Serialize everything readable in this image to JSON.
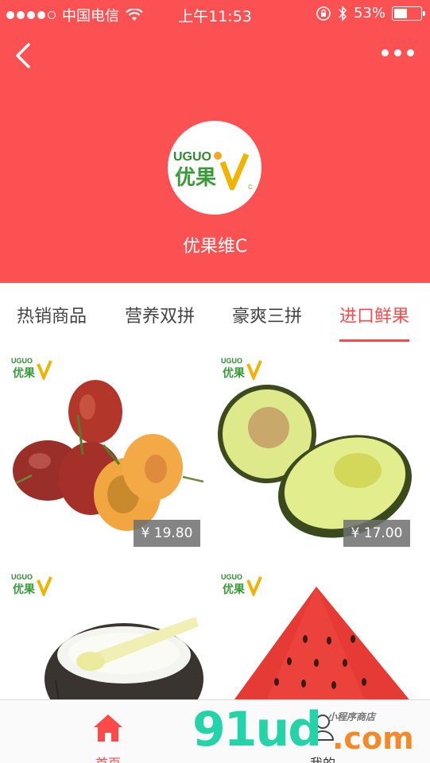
{
  "status_bar": {
    "carrier": "中国电信",
    "time": "上午11:53",
    "battery": "53%",
    "battery_level": 0.53
  },
  "header": {
    "store_name": "优果维C",
    "logo_text": "UGUO",
    "logo_cn": "优果"
  },
  "tabs": [
    {
      "label": "热销商品",
      "active": false
    },
    {
      "label": "营养双拼",
      "active": false
    },
    {
      "label": "豪爽三拼",
      "active": false
    },
    {
      "label": "进口鲜果",
      "active": true
    }
  ],
  "products": [
    {
      "image": "plum",
      "price": "¥ 19.80"
    },
    {
      "image": "avocado",
      "price": "¥ 17.00"
    },
    {
      "image": "coconut",
      "price": ""
    },
    {
      "image": "watermelon",
      "price": ""
    }
  ],
  "tab_bar": {
    "home_label": "首页",
    "mine_label": "我的"
  },
  "watermark": {
    "main": "91ud",
    "com": ".com",
    "sub": "小程序商店"
  },
  "colors": {
    "brand_red": "#fc5152",
    "accent": "#fc4a4a"
  }
}
